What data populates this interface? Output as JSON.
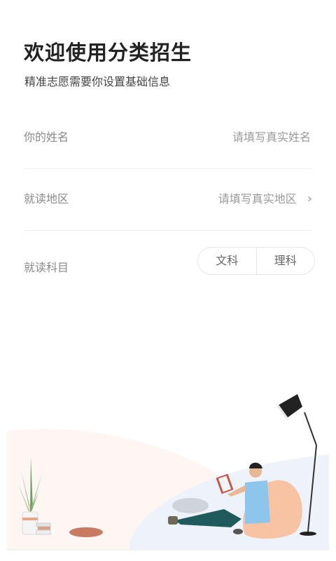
{
  "header": {
    "title": "欢迎使用分类招生",
    "subtitle": "精准志愿需要你设置基础信息"
  },
  "form": {
    "name": {
      "label": "你的姓名",
      "placeholder": "请填写真实姓名"
    },
    "region": {
      "label": "就读地区",
      "placeholder": "请填写真实地区"
    },
    "subject": {
      "label": "就读科目",
      "options": [
        "文科",
        "理科"
      ]
    }
  },
  "colors": {
    "accent": "#f7c3a2",
    "shirt": "#8cc6ec",
    "pants": "#1f5b5c"
  }
}
